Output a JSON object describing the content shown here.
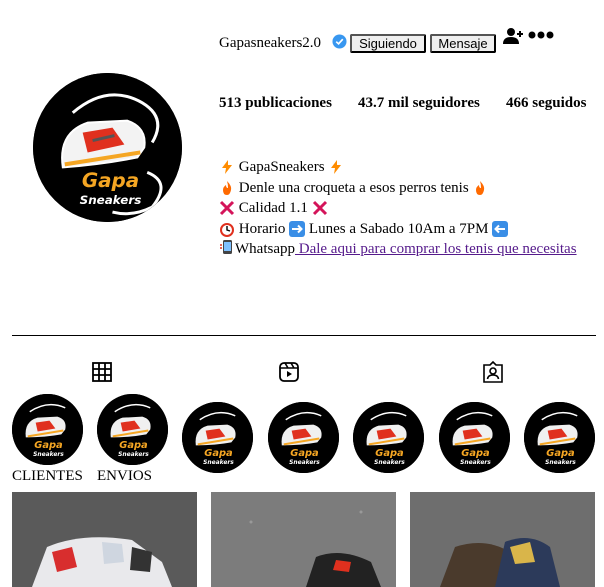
{
  "profile": {
    "username": "Gapasneakers2.0",
    "follow_label": "Siguiendo",
    "message_label": "Mensaje",
    "avatar_text_top": "Gapa",
    "avatar_text_bottom": "Sneakers"
  },
  "stats": {
    "posts": "513 publicaciones",
    "followers": "43.7 mil seguidores",
    "following": "466 seguidos"
  },
  "bio": {
    "line1": "GapaSneakers",
    "line2": "Denle una croqueta a esos perros tenis",
    "line3": "Calidad 1.1",
    "line4_a": "Horario",
    "line4_b": "Lunes a Sabado 10Am a 7PM",
    "line5_prefix": "Whatsapp",
    "line5_link": " Dale aqui para comprar los tenis que necesitas"
  },
  "tabs": [
    "grid-icon",
    "reels-icon",
    "tagged-icon"
  ],
  "highlights": [
    {
      "label": "CLIENTES"
    },
    {
      "label": "ENVIOS"
    },
    {
      "label": ""
    },
    {
      "label": ""
    },
    {
      "label": ""
    },
    {
      "label": ""
    },
    {
      "label": ""
    }
  ],
  "colors": {
    "link": "#551a8b",
    "verified": "#3897f0",
    "brand_orange": "#f5a623",
    "brand_red": "#e0301e"
  }
}
